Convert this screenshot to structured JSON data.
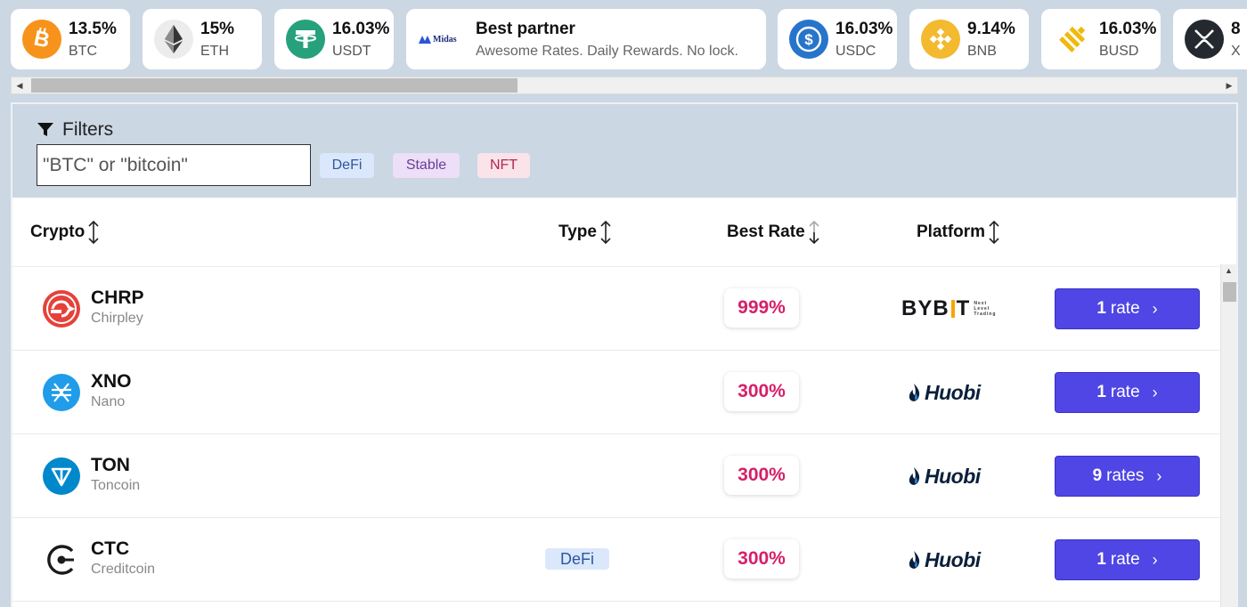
{
  "ticker": [
    {
      "rate": "13.5%",
      "symbol": "BTC",
      "icon": "bitcoin-icon",
      "color": "#f7931a"
    },
    {
      "rate": "15%",
      "symbol": "ETH",
      "icon": "ethereum-icon",
      "color": "#ececec"
    },
    {
      "rate": "16.03%",
      "symbol": "USDT",
      "icon": "tether-icon",
      "color": "#26a17b"
    },
    {
      "rate": "16.03%",
      "symbol": "USDC",
      "icon": "usdc-icon",
      "color": "#2775ca"
    },
    {
      "rate": "9.14%",
      "symbol": "BNB",
      "icon": "bnb-icon",
      "color": "#f3ba2f"
    },
    {
      "rate": "16.03%",
      "symbol": "BUSD",
      "icon": "busd-icon",
      "color": "#f0b90b"
    },
    {
      "rate": "8",
      "symbol": "X",
      "icon": "xrp-icon",
      "color": "#23292f"
    }
  ],
  "partner": {
    "brand": "Midas",
    "title": "Best partner",
    "subtitle": "Awesome Rates. Daily Rewards. No lock."
  },
  "filters": {
    "label": "Filters",
    "search_value": "\"BTC\" or \"bitcoin\"",
    "chips": [
      "DeFi",
      "Stable",
      "NFT"
    ]
  },
  "table": {
    "columns": [
      "Crypto",
      "Type",
      "Best Rate",
      "Platform"
    ],
    "rows": [
      {
        "symbol": "CHRP",
        "name": "Chirpley",
        "type": "",
        "rate": "999%",
        "platform": "Bybit",
        "platform_tag": "Next Level Trading",
        "button_count": "1",
        "button_unit": "rate",
        "logo": "chirpley-logo",
        "logo_color": "#e5413a"
      },
      {
        "symbol": "XNO",
        "name": "Nano",
        "type": "",
        "rate": "300%",
        "platform": "Huobi",
        "button_count": "1",
        "button_unit": "rate",
        "logo": "nano-logo",
        "logo_color": "#209ce9"
      },
      {
        "symbol": "TON",
        "name": "Toncoin",
        "type": "",
        "rate": "300%",
        "platform": "Huobi",
        "button_count": "9",
        "button_unit": "rates",
        "logo": "toncoin-logo",
        "logo_color": "#0088cc"
      },
      {
        "symbol": "CTC",
        "name": "Creditcoin",
        "type": "DeFi",
        "rate": "300%",
        "platform": "Huobi",
        "button_count": "1",
        "button_unit": "rate",
        "logo": "creditcoin-logo",
        "logo_color": "#1a1a1a"
      }
    ]
  },
  "colors": {
    "accent_button": "#4f46e5",
    "rate_text": "#d61f69",
    "filter_bg": "#cbd7e3"
  }
}
